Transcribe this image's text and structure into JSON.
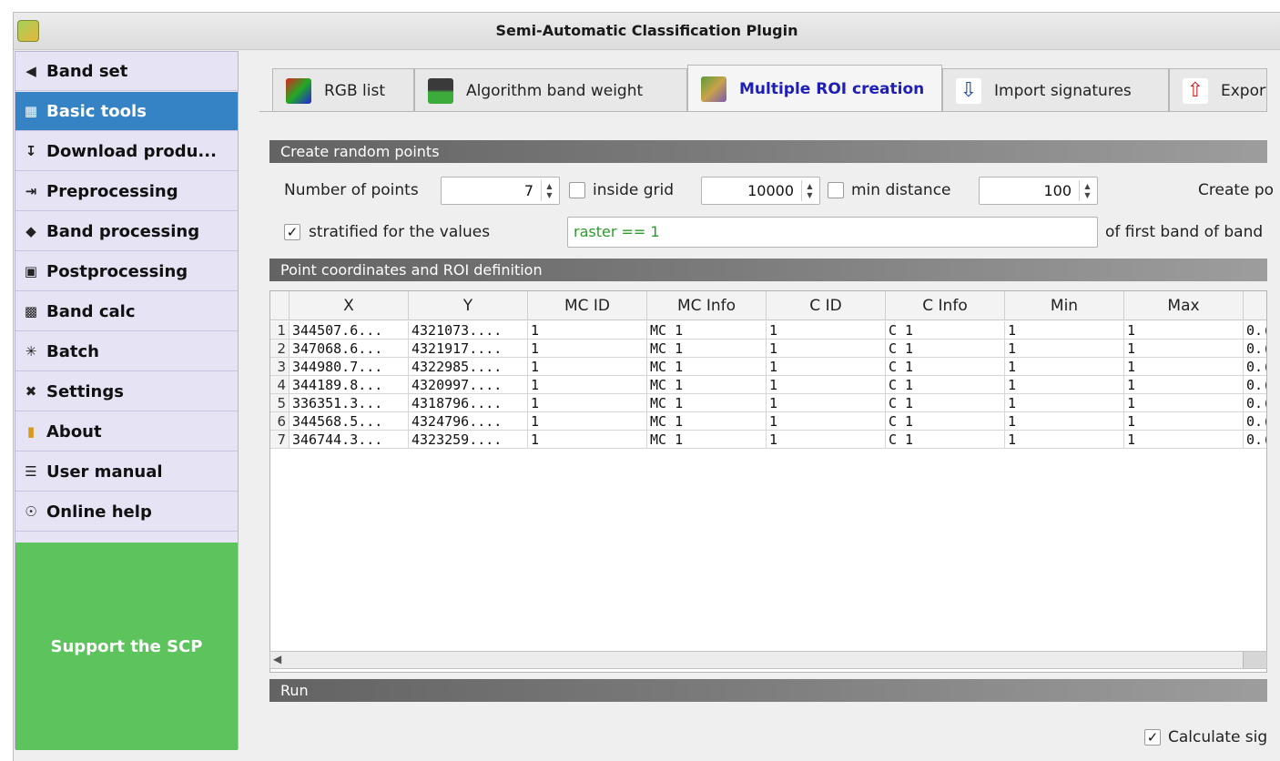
{
  "window": {
    "title": "Semi-Automatic Classification Plugin"
  },
  "sidebar": {
    "items": [
      {
        "label": "Band set",
        "icon": "band-set-icon",
        "active": false
      },
      {
        "label": "Basic tools",
        "icon": "basic-tools-icon",
        "active": true
      },
      {
        "label": "Download produ...",
        "icon": "download-icon",
        "active": false
      },
      {
        "label": "Preprocessing",
        "icon": "preprocessing-icon",
        "active": false
      },
      {
        "label": "Band processing",
        "icon": "band-processing-icon",
        "active": false
      },
      {
        "label": "Postprocessing",
        "icon": "postprocessing-icon",
        "active": false
      },
      {
        "label": "Band calc",
        "icon": "calculator-icon",
        "active": false
      },
      {
        "label": "Batch",
        "icon": "batch-icon",
        "active": false
      },
      {
        "label": "Settings",
        "icon": "settings-icon",
        "active": false
      },
      {
        "label": "About",
        "icon": "about-icon",
        "active": false
      },
      {
        "label": "User manual",
        "icon": "manual-icon",
        "active": false
      },
      {
        "label": "Online help",
        "icon": "help-icon",
        "active": false
      }
    ],
    "support_label": "Support the SCP"
  },
  "tabs": [
    {
      "label": "RGB list",
      "active": false
    },
    {
      "label": "Algorithm band weight",
      "active": false
    },
    {
      "label": "Multiple ROI creation",
      "active": true
    },
    {
      "label": "Import signatures",
      "active": false
    },
    {
      "label": "Export",
      "active": false
    }
  ],
  "random_points": {
    "section_title": "Create random points",
    "number_of_points_label": "Number of points",
    "number_of_points": "7",
    "inside_grid_label": "inside grid",
    "inside_grid_checked": false,
    "grid_value": "10000",
    "min_distance_label": "min distance",
    "min_distance_checked": false,
    "min_distance_value": "100",
    "create_points_label": "Create po",
    "stratified_label": "stratified for the values",
    "stratified_checked": true,
    "expression": "raster == 1",
    "of_first_band_label": "of first band of band"
  },
  "point_table": {
    "section_title": "Point coordinates and ROI definition",
    "columns": [
      "X",
      "Y",
      "MC ID",
      "MC Info",
      "C ID",
      "C Info",
      "Min",
      "Max",
      ""
    ],
    "rows": [
      {
        "num": "1",
        "cells": [
          "344507.6...",
          "4321073....",
          "1",
          "MC 1",
          "1",
          "C 1",
          "1",
          "1",
          "0.("
        ]
      },
      {
        "num": "2",
        "cells": [
          "347068.6...",
          "4321917....",
          "1",
          "MC 1",
          "1",
          "C 1",
          "1",
          "1",
          "0.("
        ]
      },
      {
        "num": "3",
        "cells": [
          "344980.7...",
          "4322985....",
          "1",
          "MC 1",
          "1",
          "C 1",
          "1",
          "1",
          "0.("
        ]
      },
      {
        "num": "4",
        "cells": [
          "344189.8...",
          "4320997....",
          "1",
          "MC 1",
          "1",
          "C 1",
          "1",
          "1",
          "0.("
        ]
      },
      {
        "num": "5",
        "cells": [
          "336351.3...",
          "4318796....",
          "1",
          "MC 1",
          "1",
          "C 1",
          "1",
          "1",
          "0.("
        ]
      },
      {
        "num": "6",
        "cells": [
          "344568.5...",
          "4324796....",
          "1",
          "MC 1",
          "1",
          "C 1",
          "1",
          "1",
          "0.("
        ]
      },
      {
        "num": "7",
        "cells": [
          "346744.3...",
          "4323259....",
          "1",
          "MC 1",
          "1",
          "C 1",
          "1",
          "1",
          "0.("
        ]
      }
    ]
  },
  "run": {
    "section_title": "Run",
    "calculate_label": "Calculate sig",
    "calculate_checked": true
  }
}
